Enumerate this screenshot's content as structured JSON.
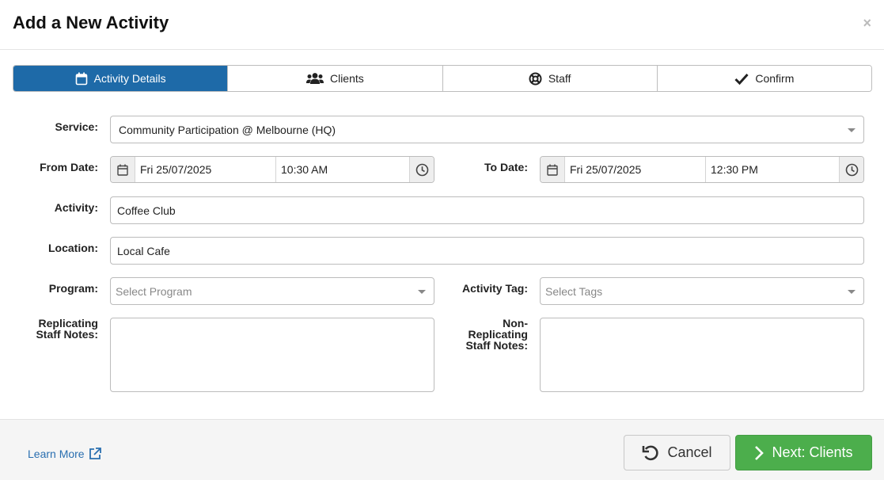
{
  "dialog": {
    "title": "Add a New Activity",
    "close_symbol": "×"
  },
  "tabs": [
    {
      "label": "Activity Details",
      "icon": "calendar-icon",
      "active": true
    },
    {
      "label": "Clients",
      "icon": "users-icon",
      "active": false
    },
    {
      "label": "Staff",
      "icon": "lifebuoy-icon",
      "active": false
    },
    {
      "label": "Confirm",
      "icon": "check-icon",
      "active": false
    }
  ],
  "form": {
    "service": {
      "label": "Service:",
      "value": "Community Participation @ Melbourne (HQ)"
    },
    "from_date": {
      "label": "From Date:",
      "date": "Fri 25/07/2025",
      "time": "10:30 AM"
    },
    "to_date": {
      "label": "To Date:",
      "date": "Fri 25/07/2025",
      "time": "12:30 PM"
    },
    "activity": {
      "label": "Activity:",
      "value": "Coffee Club"
    },
    "location": {
      "label": "Location:",
      "value": "Local Cafe"
    },
    "program": {
      "label": "Program:",
      "placeholder": "Select Program"
    },
    "activity_tag": {
      "label": "Activity Tag:",
      "placeholder": "Select Tags"
    },
    "replicating_notes": {
      "label_line1": "Replicating",
      "label_line2": "Staff Notes:"
    },
    "non_replicating_notes": {
      "label_line1": "Non-",
      "label_line2": "Replicating",
      "label_line3": "Staff Notes:"
    }
  },
  "footer": {
    "learn_more": "Learn More",
    "cancel": "Cancel",
    "next": "Next: Clients"
  },
  "colors": {
    "primary": "#1e6aa8",
    "success": "#4cae4c",
    "link": "#2a6fb0"
  }
}
